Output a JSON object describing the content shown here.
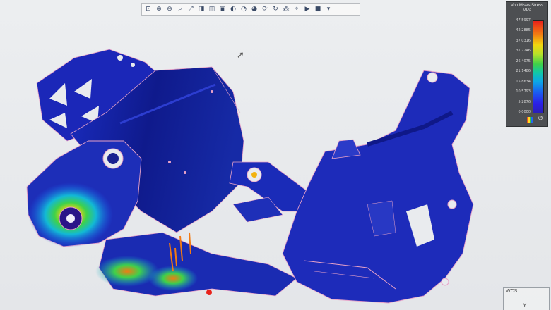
{
  "toolbar": {
    "tools": [
      {
        "name": "zoom-fit-icon",
        "glyph": "⊡"
      },
      {
        "name": "zoom-in-icon",
        "glyph": "⊕"
      },
      {
        "name": "zoom-out-icon",
        "glyph": "⊖"
      },
      {
        "name": "zoom-area-icon",
        "glyph": "⌕"
      },
      {
        "name": "previous-view-icon",
        "glyph": "⤢"
      },
      {
        "name": "section-view-icon",
        "glyph": "◨"
      },
      {
        "name": "view-orientation-icon",
        "glyph": "◫"
      },
      {
        "name": "display-style-icon",
        "glyph": "▣"
      },
      {
        "name": "hide-show-icon",
        "glyph": "◐"
      },
      {
        "name": "edit-appearance-icon",
        "glyph": "◔"
      },
      {
        "name": "scene-icon",
        "glyph": "◕"
      },
      {
        "name": "view-settings-icon",
        "glyph": "⟳"
      },
      {
        "name": "rotate-icon",
        "glyph": "↻"
      },
      {
        "name": "deformed-plot-icon",
        "glyph": "⁂"
      },
      {
        "name": "probe-icon",
        "glyph": "⌖"
      },
      {
        "name": "animate-icon",
        "glyph": "▶"
      },
      {
        "name": "capture-icon",
        "glyph": "■"
      },
      {
        "name": "more-icon",
        "glyph": "▾"
      }
    ]
  },
  "legend": {
    "title": "Von Mises Stress",
    "unit": "MPa",
    "labels": [
      "47.5997",
      "42.2885",
      "37.0316",
      "31.7246",
      "26.4075",
      "21.1486",
      "15.8634",
      "10.5793",
      "5.2876",
      "0.0000"
    ],
    "colors": {
      "max": "#e8221b",
      "min": "#2a1fb8"
    }
  },
  "triad": {
    "label": "WCS",
    "axis": "Y"
  },
  "model": {
    "part_color": "#1f23a8",
    "edge_color": "#e8a2c8"
  }
}
